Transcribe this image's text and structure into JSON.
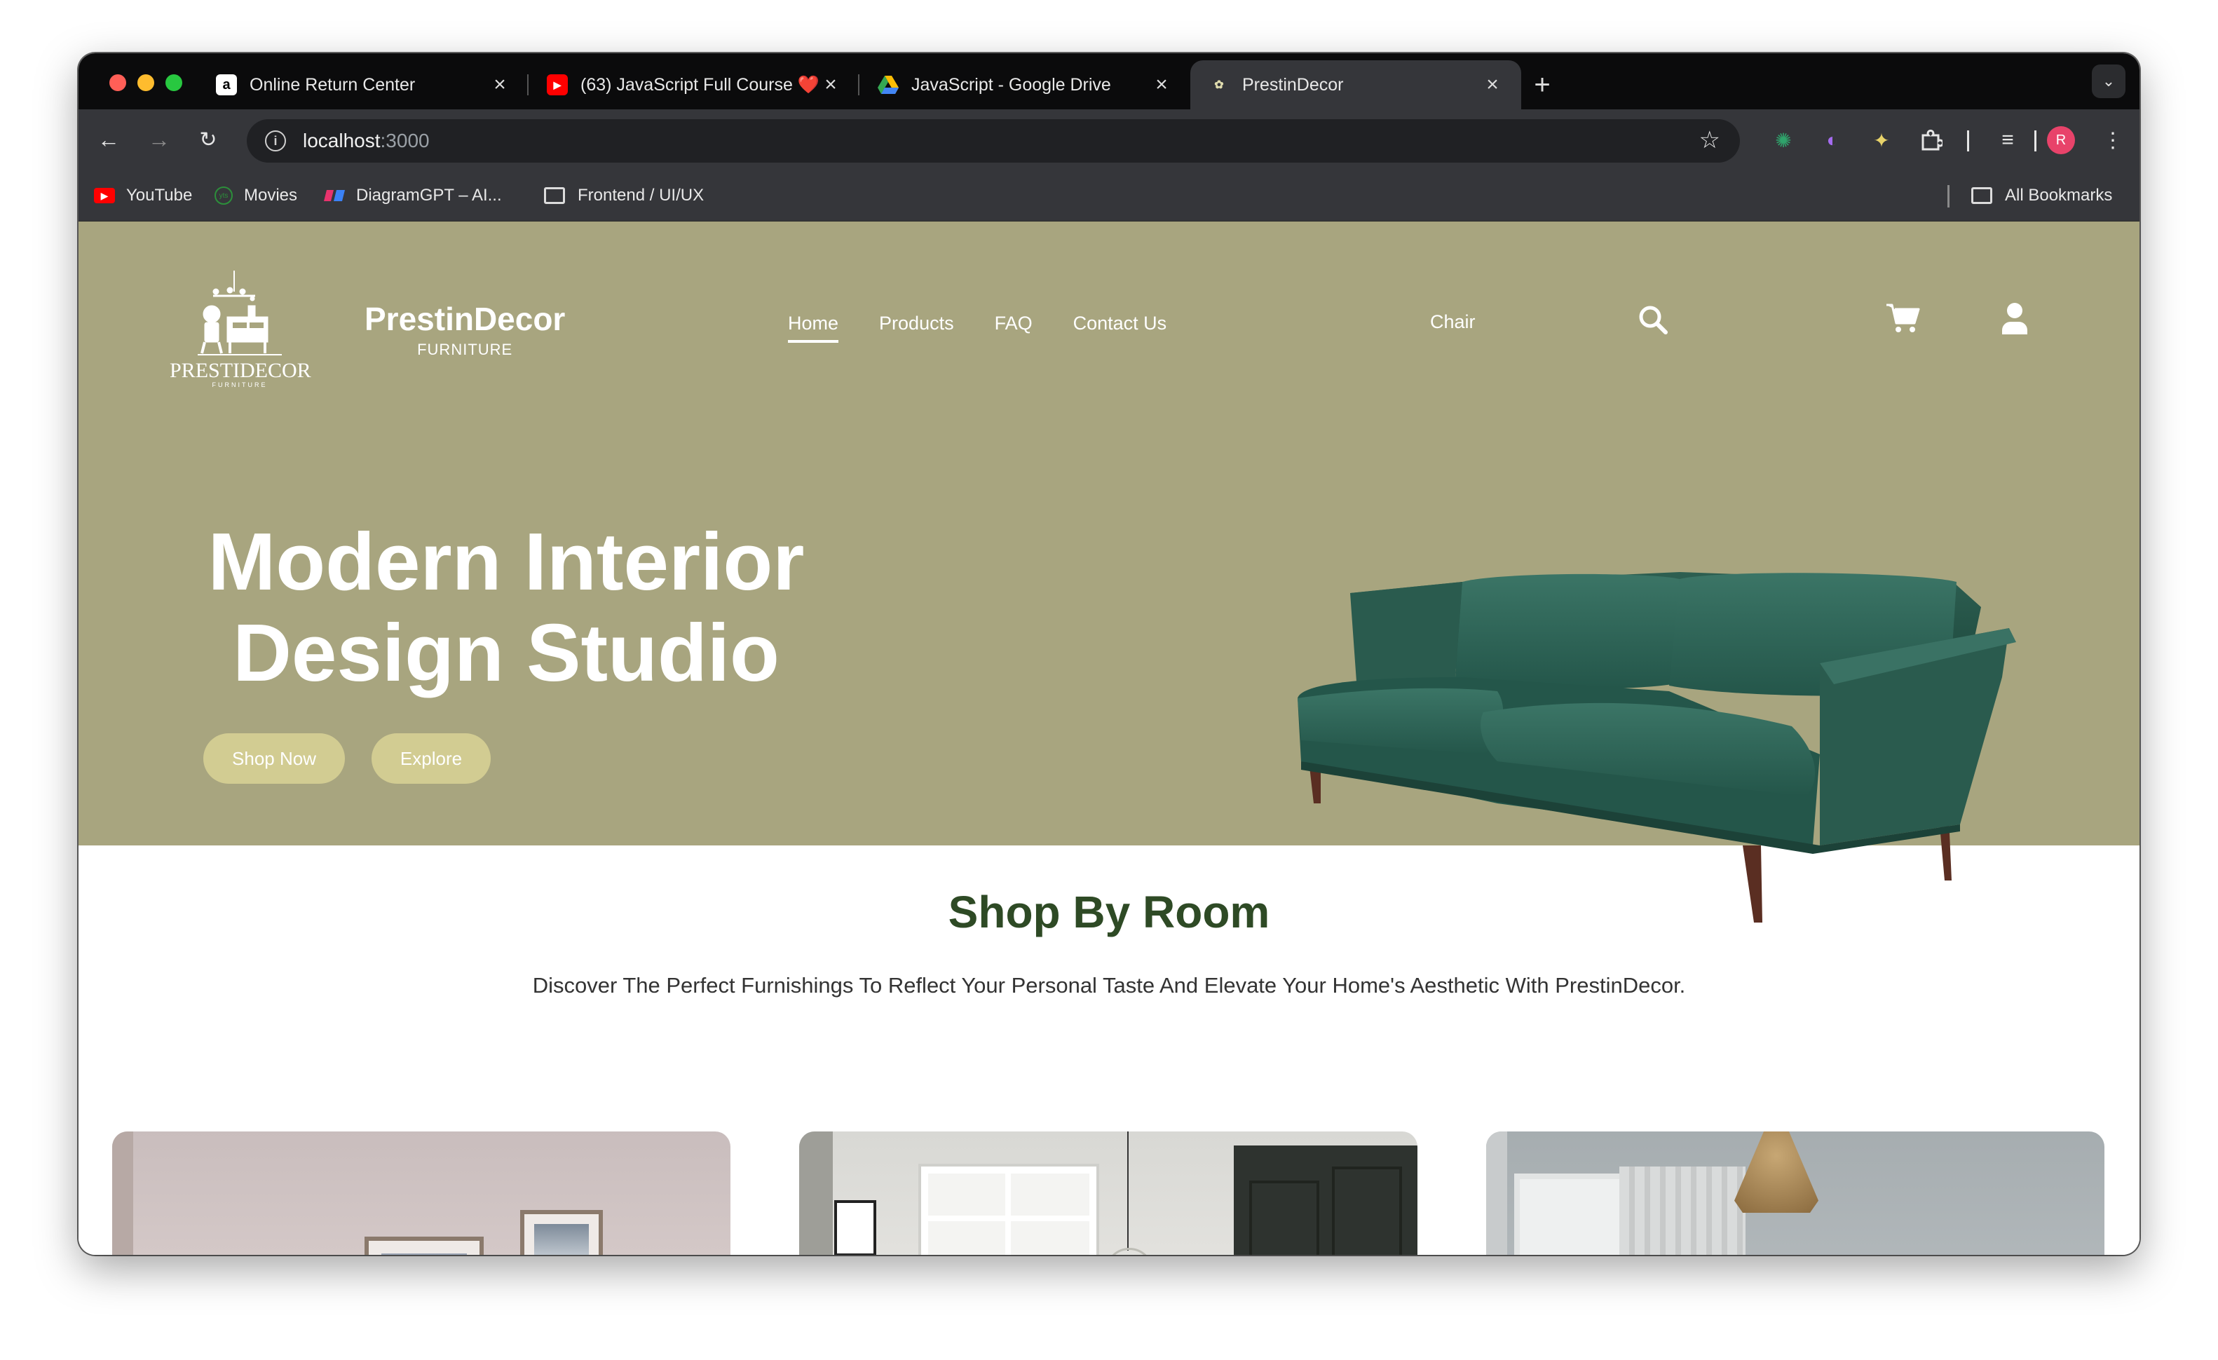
{
  "browser": {
    "tabs": [
      {
        "title": "Online Return Center",
        "favicon": "amazon-icon"
      },
      {
        "title": "(63) JavaScript Full Course ❤️",
        "favicon": "youtube-icon"
      },
      {
        "title": "JavaScript - Google Drive",
        "favicon": "google-drive-icon"
      },
      {
        "title": "PrestinDecor",
        "favicon": "site-icon",
        "active": true
      }
    ],
    "address": {
      "host": "localhost",
      "port": ":3000"
    },
    "profile_initial": "R",
    "bookmarks": [
      {
        "label": "YouTube",
        "icon": "youtube-icon"
      },
      {
        "label": "Movies",
        "icon": "movies-icon"
      },
      {
        "label": "DiagramGPT – AI...",
        "icon": "diagramgpt-icon"
      },
      {
        "label": "Frontend / UI/UX",
        "icon": "folder-icon"
      }
    ],
    "all_bookmarks": "All Bookmarks"
  },
  "site": {
    "logo_text": "PRESTIDECOR",
    "logo_sub": "FURNITURE",
    "brand_name": "PrestinDecor",
    "brand_sub": "FURNITURE",
    "nav": [
      "Home",
      "Products",
      "FAQ",
      "Contact Us"
    ],
    "active_nav": "Home",
    "search_value": "Chair",
    "hero": {
      "line1": "Modern Interior",
      "line2": "Design Studio",
      "shop_now": "Shop Now",
      "explore": "Explore"
    },
    "shop_by_room": {
      "title": "Shop By Room",
      "subtitle": "Discover The Perfect Furnishings To Reflect Your Personal Taste And Elevate Your Home's Aesthetic With PrestinDecor."
    }
  },
  "colors": {
    "hero_bg": "#a8a57f",
    "button_bg": "#d2cc92",
    "title_green": "#2e4a25",
    "sofa_green": "#2f6356"
  }
}
